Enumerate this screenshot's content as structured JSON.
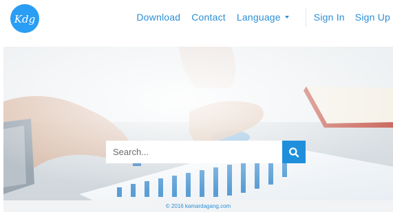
{
  "brand": {
    "logo_text": "Kdg",
    "color": "#2a9df4"
  },
  "nav": {
    "download": "Download",
    "contact": "Contact",
    "language": "Language",
    "sign_in": "Sign In",
    "sign_up": "Sign Up"
  },
  "search": {
    "placeholder": "Search...",
    "icon": "search-icon",
    "button_color": "#1f8fdc"
  },
  "footer": {
    "copyright": "© 2016 kamardagang.com"
  },
  "colors": {
    "link": "#2a8fd6",
    "accent": "#1f8fdc"
  }
}
